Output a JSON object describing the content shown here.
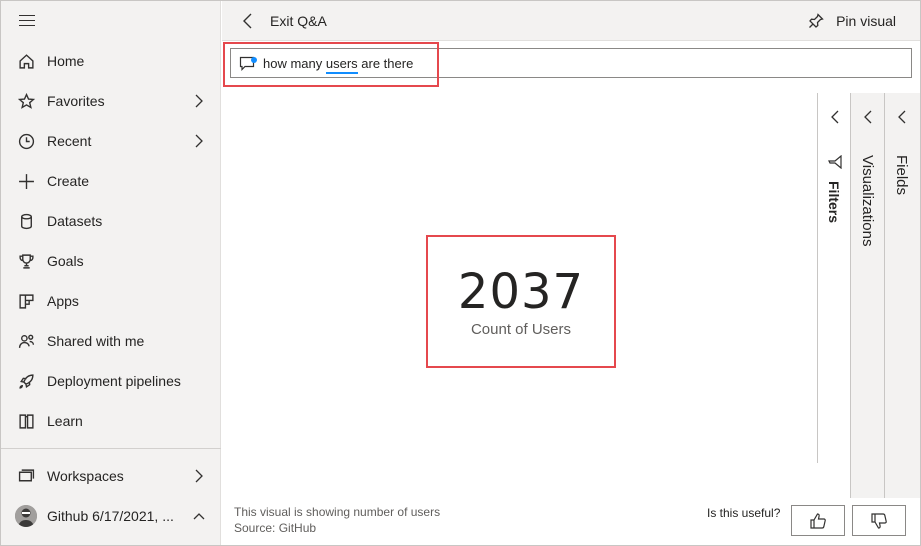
{
  "sidebar": {
    "items": [
      {
        "label": "Home",
        "icon": "home-icon"
      },
      {
        "label": "Favorites",
        "icon": "star-icon"
      },
      {
        "label": "Recent",
        "icon": "clock-icon"
      },
      {
        "label": "Create",
        "icon": "plus-icon"
      },
      {
        "label": "Datasets",
        "icon": "database-icon"
      },
      {
        "label": "Goals",
        "icon": "trophy-icon"
      },
      {
        "label": "Apps",
        "icon": "apps-icon"
      },
      {
        "label": "Shared with me",
        "icon": "shared-icon"
      },
      {
        "label": "Deployment pipelines",
        "icon": "rocket-icon"
      },
      {
        "label": "Learn",
        "icon": "book-icon"
      }
    ],
    "workspaces": {
      "label": "Workspaces",
      "icon": "workspaces-icon"
    },
    "current_workspace": {
      "label": "Github 6/17/2021, ..."
    }
  },
  "topbar": {
    "exit_label": "Exit Q&A",
    "pin_label": "Pin visual"
  },
  "qna": {
    "text_before": "how many ",
    "keyword": "users",
    "text_after": " are there"
  },
  "card": {
    "value": "2037",
    "caption": "Count of Users"
  },
  "panes": {
    "filters": "Filters",
    "visualizations": "Visualizations",
    "fields": "Fields"
  },
  "footer": {
    "info_line1": "This visual is showing number of users",
    "info_line2": "Source: GitHub",
    "useful_label": "Is this useful?"
  },
  "colors": {
    "accent": "#118dff",
    "highlight": "#e5484d",
    "sidebar_bg": "#f3f2f1"
  }
}
